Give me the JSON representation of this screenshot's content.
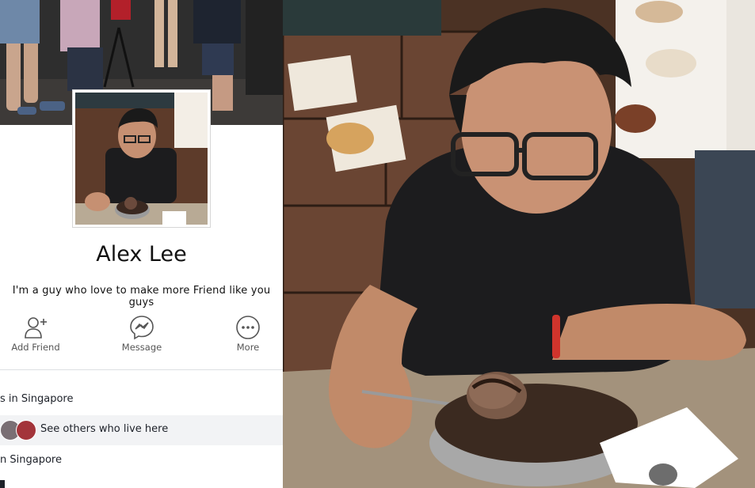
{
  "profile": {
    "name": "Alex Lee",
    "bio": "I'm a guy who love to make more Friend like you guys"
  },
  "actions": [
    {
      "label": "Add Friend",
      "icon": "add-friend-icon"
    },
    {
      "label": "Message",
      "icon": "messenger-icon"
    },
    {
      "label": "More",
      "icon": "more-icon"
    }
  ],
  "info": {
    "lives_in": "s in Singapore",
    "see_others": "See others who live here",
    "from": "n Singapore"
  },
  "colors": {
    "text": "#1d2129",
    "muted": "#555555",
    "highlight_bg": "#f2f3f5",
    "divider": "#dddfe2",
    "bracelet": "#d0342c",
    "shirt": "#1c1c1e"
  }
}
